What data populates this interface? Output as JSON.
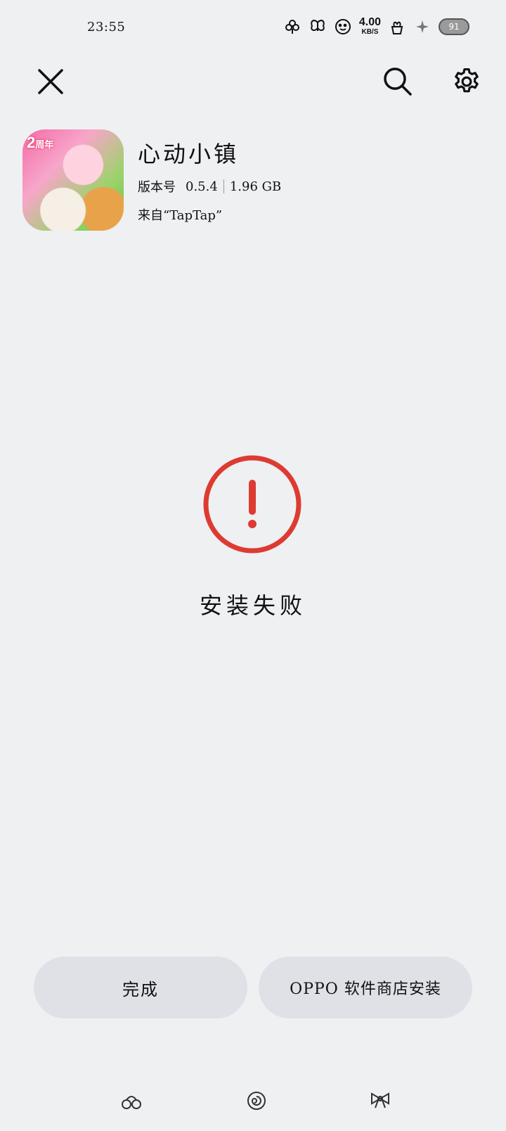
{
  "status_bar": {
    "time": "23:55",
    "net_speed_value": "4.00",
    "net_speed_unit": "KB/S",
    "battery_level": "91",
    "icons": [
      "clover-icon",
      "butterfly-icon",
      "face-icon",
      "flower-pot-icon",
      "sparkle-icon",
      "battery-icon"
    ]
  },
  "toolbar": {
    "close_icon": "close-icon",
    "search_icon": "search-icon",
    "settings_icon": "gear-icon"
  },
  "app": {
    "name": "心动小镇",
    "version_label": "版本号",
    "version": "0.5.4",
    "size": "1.96 GB",
    "source": "来自“TapTap”",
    "icon_badge_number": "2",
    "icon_badge_text": "周年"
  },
  "result": {
    "status_text": "安装失败",
    "accent_color": "#dd3b32"
  },
  "buttons": {
    "done_label": "完成",
    "store_install_label": "OPPO 软件商店安装"
  },
  "nav_bar": {
    "back_icon": "back-icon",
    "home_icon": "home-icon",
    "recent_icon": "recent-apps-icon"
  }
}
